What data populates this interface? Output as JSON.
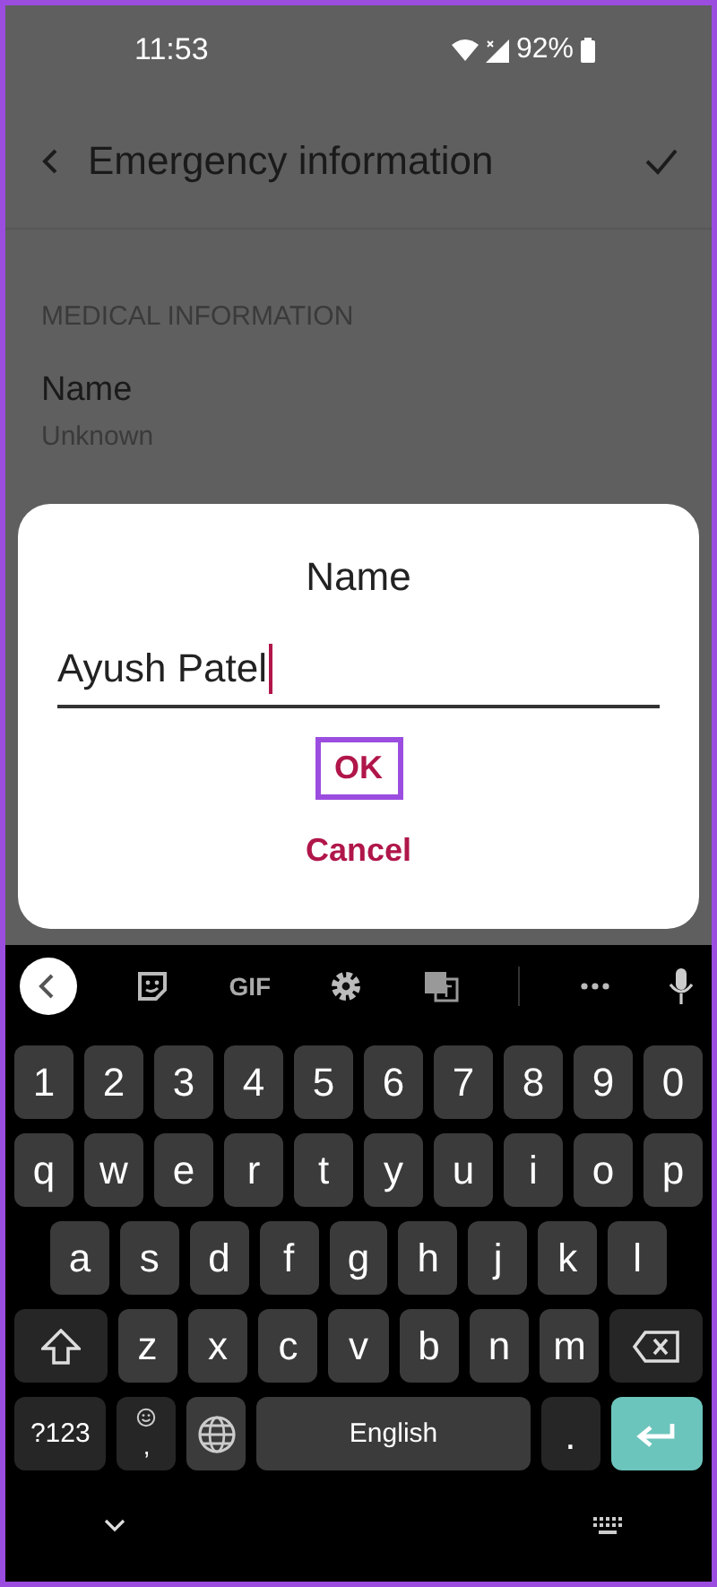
{
  "status_bar": {
    "time": "11:53",
    "battery": "92%"
  },
  "header": {
    "title": "Emergency information"
  },
  "section": {
    "heading": "MEDICAL INFORMATION",
    "items": [
      {
        "label": "Name",
        "value": "Unknown"
      }
    ]
  },
  "dialog": {
    "title": "Name",
    "input_value": "Ayush Patel",
    "ok": {
      "label": "OK",
      "highlighted": true
    },
    "cancel": "Cancel"
  },
  "keyboard": {
    "toolbar": [
      {
        "kind": "back"
      },
      {
        "kind": "sticker"
      },
      {
        "kind": "gif",
        "label": "GIF"
      },
      {
        "kind": "settings"
      },
      {
        "kind": "translate"
      },
      {
        "kind": "more"
      },
      {
        "kind": "mic"
      }
    ],
    "rows": [
      [
        {
          "kind": "key",
          "label": "1"
        },
        {
          "kind": "key",
          "label": "2"
        },
        {
          "kind": "key",
          "label": "3"
        },
        {
          "kind": "key",
          "label": "4"
        },
        {
          "kind": "key",
          "label": "5"
        },
        {
          "kind": "key",
          "label": "6"
        },
        {
          "kind": "key",
          "label": "7"
        },
        {
          "kind": "key",
          "label": "8"
        },
        {
          "kind": "key",
          "label": "9"
        },
        {
          "kind": "key",
          "label": "0"
        }
      ],
      [
        {
          "kind": "key",
          "label": "q"
        },
        {
          "kind": "key",
          "label": "w"
        },
        {
          "kind": "key",
          "label": "e"
        },
        {
          "kind": "key",
          "label": "r"
        },
        {
          "kind": "key",
          "label": "t"
        },
        {
          "kind": "key",
          "label": "y"
        },
        {
          "kind": "key",
          "label": "u"
        },
        {
          "kind": "key",
          "label": "i"
        },
        {
          "kind": "key",
          "label": "o"
        },
        {
          "kind": "key",
          "label": "p"
        }
      ],
      [
        {
          "kind": "key",
          "label": "a"
        },
        {
          "kind": "key",
          "label": "s"
        },
        {
          "kind": "key",
          "label": "d"
        },
        {
          "kind": "key",
          "label": "f"
        },
        {
          "kind": "key",
          "label": "g"
        },
        {
          "kind": "key",
          "label": "h"
        },
        {
          "kind": "key",
          "label": "j"
        },
        {
          "kind": "key",
          "label": "k"
        },
        {
          "kind": "key",
          "label": "l"
        }
      ],
      [
        {
          "kind": "shift"
        },
        {
          "kind": "key",
          "label": "z"
        },
        {
          "kind": "key",
          "label": "x"
        },
        {
          "kind": "key",
          "label": "c"
        },
        {
          "kind": "key",
          "label": "v"
        },
        {
          "kind": "key",
          "label": "b"
        },
        {
          "kind": "key",
          "label": "n"
        },
        {
          "kind": "key",
          "label": "m"
        },
        {
          "kind": "backspace"
        }
      ]
    ],
    "bottom_row": {
      "symbols_key": "?123",
      "emoji_key": ",",
      "space_key": "English",
      "period_key": "."
    }
  }
}
